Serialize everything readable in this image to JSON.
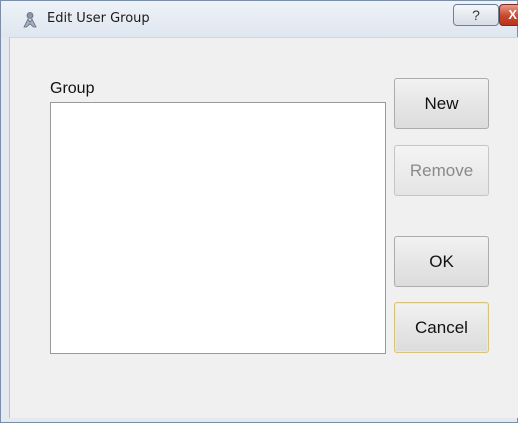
{
  "window": {
    "title": "Edit User Group",
    "help_label": "?",
    "close_label": "X"
  },
  "group": {
    "label": "Group",
    "items": []
  },
  "buttons": {
    "new": "New",
    "remove": "Remove",
    "ok": "OK",
    "cancel": "Cancel"
  },
  "colors": {
    "titlebar": "#dfe6ef",
    "close_button": "#c9462e",
    "client_background": "#f0f0f0"
  }
}
